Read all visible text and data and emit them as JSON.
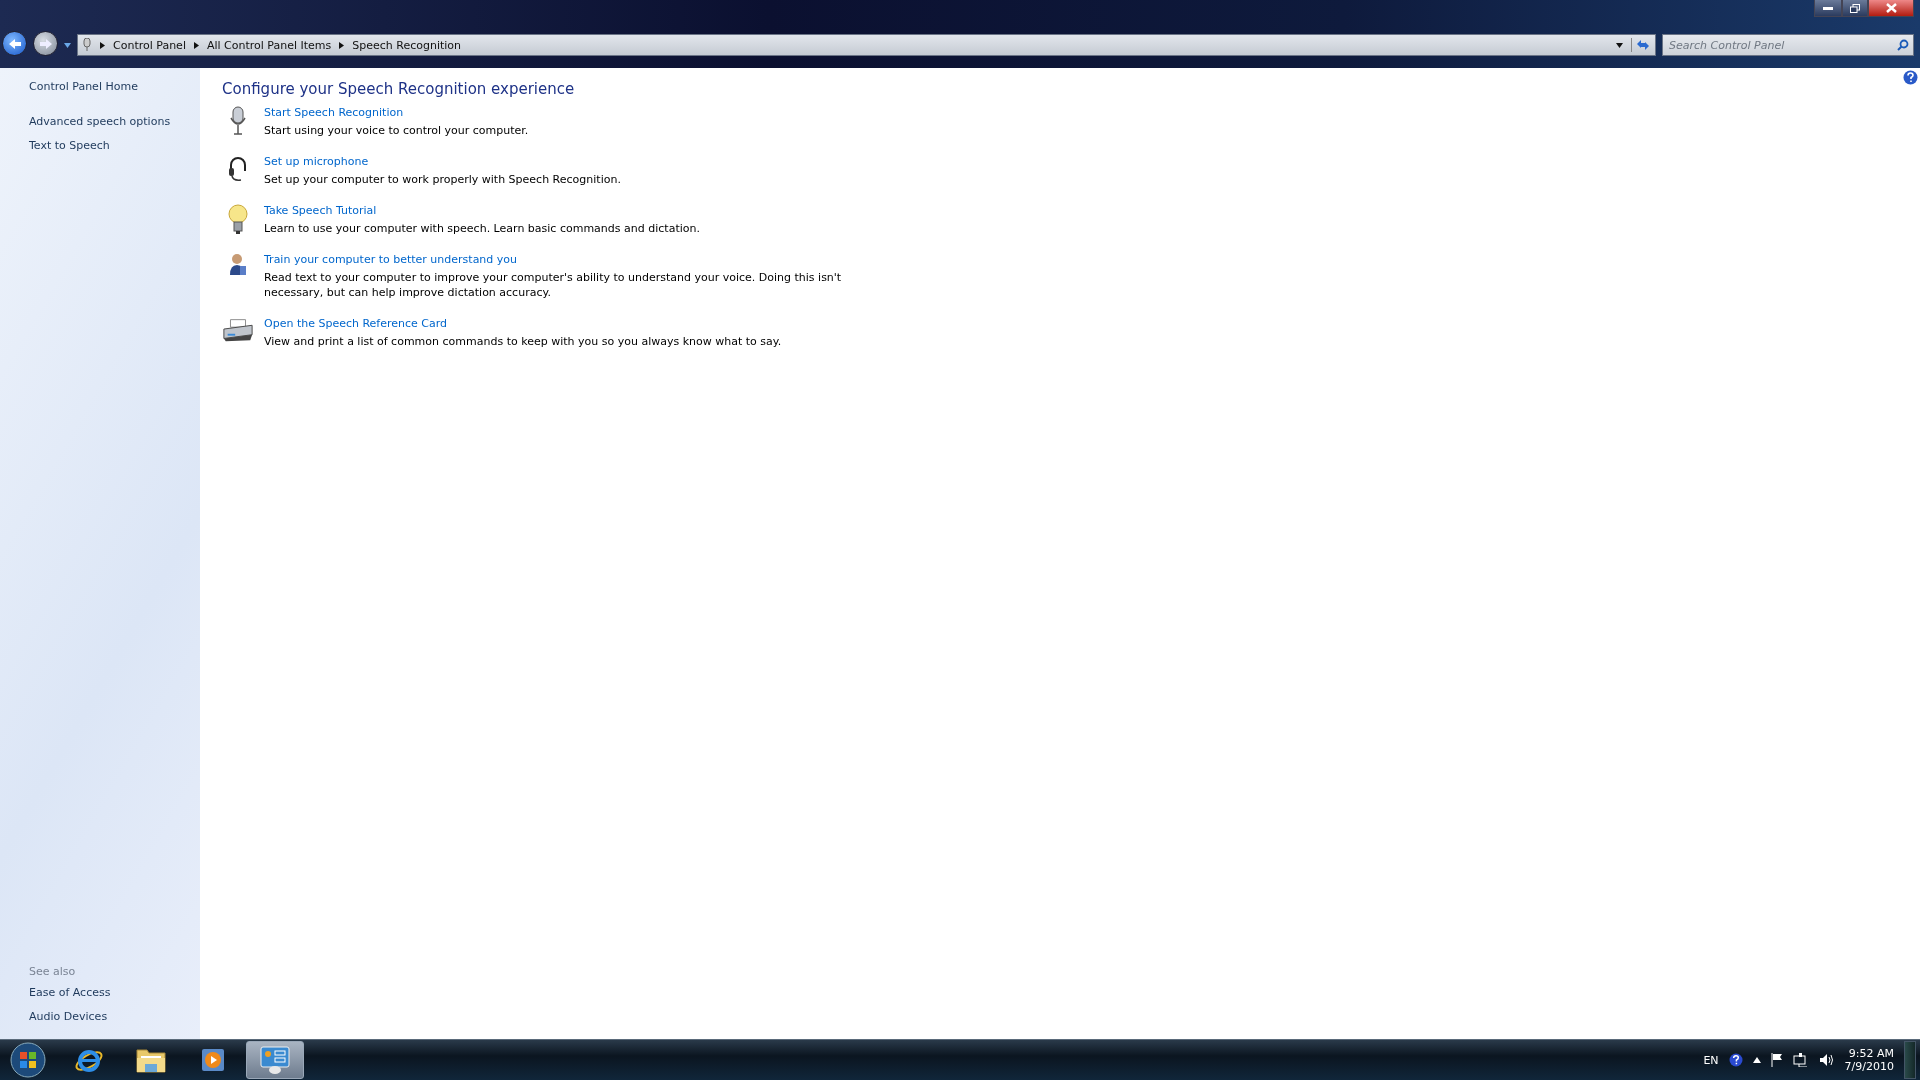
{
  "address_bar": {
    "breadcrumbs": [
      "Control Panel",
      "All Control Panel Items",
      "Speech Recognition"
    ]
  },
  "search": {
    "placeholder": "Search Control Panel"
  },
  "sidebar": {
    "items": [
      "Control Panel Home",
      "Advanced speech options",
      "Text to Speech"
    ],
    "see_also_title": "See also",
    "see_also": [
      "Ease of Access",
      "Audio Devices"
    ]
  },
  "content": {
    "title": "Configure your Speech Recognition experience",
    "tasks": [
      {
        "kind": "microphone",
        "link": "Start Speech Recognition",
        "description": "Start using your voice to control your computer."
      },
      {
        "kind": "headset",
        "link": "Set up microphone",
        "description": "Set up your computer to work properly with Speech Recognition."
      },
      {
        "kind": "bulb",
        "link": "Take Speech Tutorial",
        "description": "Learn to use your computer with speech.  Learn basic commands and dictation."
      },
      {
        "kind": "person",
        "link": "Train your computer to better understand you",
        "description": "Read text to your computer to improve your computer's ability to understand your voice.  Doing this isn't necessary, but can help improve dictation accuracy."
      },
      {
        "kind": "printer",
        "link": "Open the Speech Reference Card",
        "description": "View and print a list of common commands to keep with you so you always know what to say."
      }
    ]
  },
  "taskbar": {
    "apps": [
      {
        "kind": "browser",
        "selected": false
      },
      {
        "kind": "folder",
        "selected": false
      },
      {
        "kind": "media",
        "selected": false
      },
      {
        "kind": "control-panel",
        "selected": true
      }
    ],
    "language": "EN",
    "time": "9:52 AM",
    "date": "7/9/2010"
  }
}
